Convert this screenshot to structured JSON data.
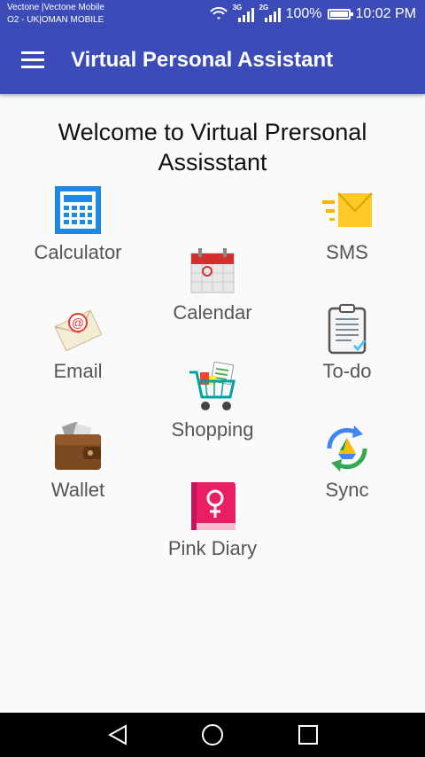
{
  "status_bar": {
    "carrier_line1": "Vectone |Vectone Mobile",
    "carrier_line2": "O2 - UK|OMAN MOBILE",
    "network1": "3G",
    "network2": "2G",
    "battery_percent": "100%",
    "battery_level": 1.0,
    "time": "10:02 PM"
  },
  "app_bar": {
    "title": "Virtual Personal Assistant"
  },
  "welcome": {
    "line1": "Welcome to Virtual Prersonal",
    "line2": "Assisstant"
  },
  "tiles": {
    "calculator": "Calculator",
    "sms": "SMS",
    "calendar": "Calendar",
    "email": "Email",
    "todo": "To-do",
    "shopping": "Shopping",
    "wallet": "Wallet",
    "sync": "Sync",
    "pink_diary": "Pink Diary"
  },
  "icons": {
    "menu": "menu-icon",
    "calculator": "calculator-icon",
    "sms": "envelope-icon",
    "calendar": "calendar-icon",
    "email": "email-icon",
    "todo": "clipboard-icon",
    "shopping": "shopping-cart-icon",
    "wallet": "wallet-icon",
    "sync": "sync-icon",
    "pink_diary": "diary-icon",
    "back": "back-icon",
    "home": "home-icon",
    "recents": "recents-icon"
  },
  "colors": {
    "primary": "#3b4cb8",
    "background": "#fafafa",
    "label": "#555555"
  }
}
